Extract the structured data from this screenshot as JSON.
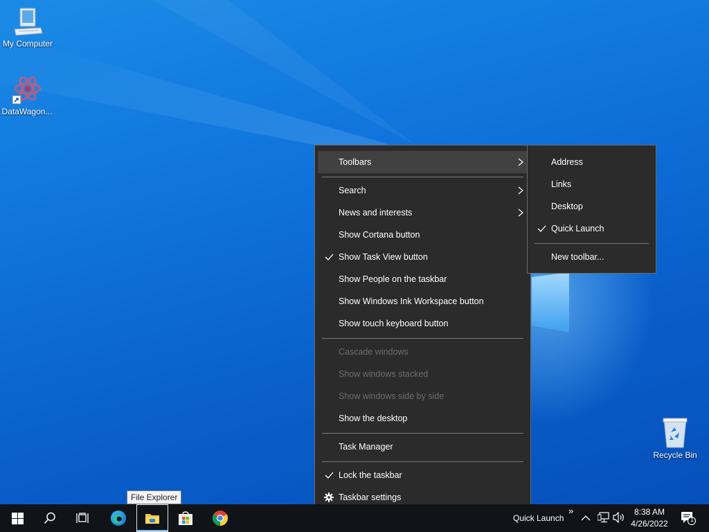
{
  "desktop": {
    "icons": [
      {
        "label": "My Computer",
        "icon": "computer-icon"
      },
      {
        "label": "DataWagon...",
        "icon": "app-shortcut-icon"
      },
      {
        "label": "Recycle Bin",
        "icon": "recycle-bin-icon"
      }
    ]
  },
  "context_menu": {
    "items": [
      {
        "label": "Toolbars",
        "has_submenu": true,
        "highlighted": true
      },
      {
        "label": "Search",
        "has_submenu": true
      },
      {
        "label": "News and interests",
        "has_submenu": true
      },
      {
        "label": "Show Cortana button"
      },
      {
        "label": "Show Task View button",
        "checked": true
      },
      {
        "label": "Show People on the taskbar"
      },
      {
        "label": "Show Windows Ink Workspace button"
      },
      {
        "label": "Show touch keyboard button"
      },
      {
        "label": "Cascade windows",
        "disabled": true
      },
      {
        "label": "Show windows stacked",
        "disabled": true
      },
      {
        "label": "Show windows side by side",
        "disabled": true
      },
      {
        "label": "Show the desktop"
      },
      {
        "label": "Task Manager"
      },
      {
        "label": "Lock the taskbar",
        "checked": true
      },
      {
        "label": "Taskbar settings",
        "icon": "gear-icon"
      }
    ]
  },
  "toolbars_submenu": {
    "items": [
      {
        "label": "Address"
      },
      {
        "label": "Links"
      },
      {
        "label": "Desktop"
      },
      {
        "label": "Quick Launch",
        "checked": true
      },
      {
        "label": "New toolbar..."
      }
    ]
  },
  "taskbar": {
    "buttons": [
      "start-icon",
      "search-icon",
      "task-view-icon",
      "edge-icon",
      "file-explorer-icon",
      "store-icon",
      "chrome-icon"
    ],
    "tooltip": "File Explorer",
    "quick_launch_label": "Quick Launch",
    "quick_launch_chevron": "»",
    "clock_time": "8:38 AM",
    "clock_date": "4/26/2022",
    "notification_count": "1"
  },
  "colors": {
    "menu_bg": "#2b2b2b",
    "menu_hover": "#414141",
    "taskbar_bg": "#101418",
    "accent": "#76b9ed"
  }
}
